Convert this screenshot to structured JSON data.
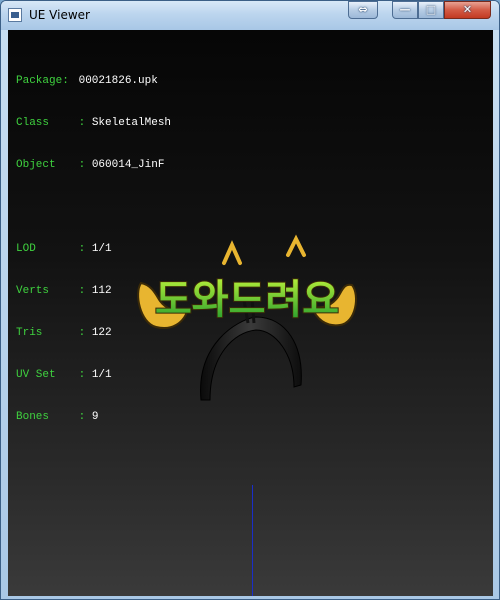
{
  "window": {
    "title": "UE Viewer",
    "controls": {
      "swap": "⇔",
      "minimize": "—",
      "maximize": "□",
      "close": "✕"
    }
  },
  "info": {
    "package": {
      "label": "Package:",
      "sep": " ",
      "value": "00021826.upk"
    },
    "class": {
      "label": "Class",
      "sep": " : ",
      "value": "SkeletalMesh"
    },
    "object": {
      "label": "Object",
      "sep": " : ",
      "value": "060014_JinF"
    },
    "lod": {
      "label": "LOD",
      "sep": " : ",
      "value": "1/1"
    },
    "verts": {
      "label": "Verts",
      "sep": " : ",
      "value": "112"
    },
    "tris": {
      "label": "Tris",
      "sep": " : ",
      "value": "122"
    },
    "uvset": {
      "label": "UV Set",
      "sep": " : ",
      "value": "1/1"
    },
    "bones": {
      "label": "Bones",
      "sep": " : ",
      "value": "9"
    }
  },
  "mesh": {
    "caption": "도와드려요",
    "colors": {
      "text_top": "#b8f03a",
      "text_bottom": "#1f9a2c",
      "outline": "#3a2a08",
      "gold": "#e8b530",
      "band": "#1b1b1b"
    }
  },
  "axis_color": "#1a2ec8"
}
